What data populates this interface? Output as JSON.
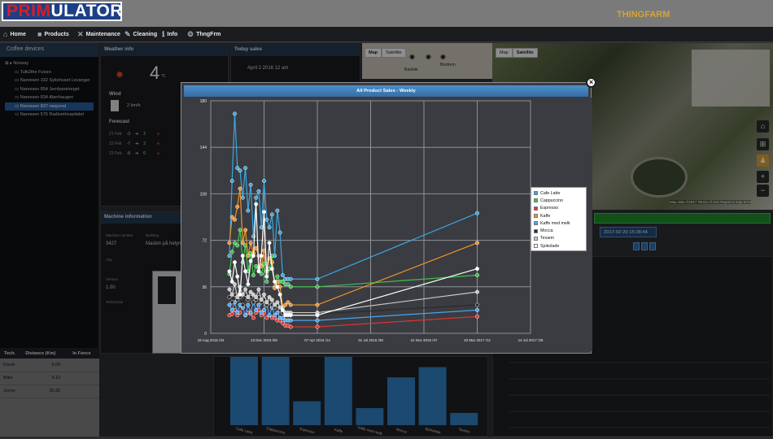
{
  "app": {
    "logo_prefix": "PRIM",
    "logo_suffix": "ULATOR",
    "brand": "THINGFARM"
  },
  "nav": [
    {
      "label": "Home",
      "icon": "home-icon",
      "glyph": "⌂"
    },
    {
      "label": "Products",
      "icon": "products-icon",
      "glyph": "■"
    },
    {
      "label": "Maintenance",
      "icon": "wrench-icon",
      "glyph": "✕"
    },
    {
      "label": "Cleaning",
      "icon": "brush-icon",
      "glyph": "✎"
    },
    {
      "label": "Info",
      "icon": "info-icon",
      "glyph": "ℹ"
    },
    {
      "label": "ThngFrm",
      "icon": "thingfarm-icon",
      "glyph": "⚙"
    }
  ],
  "sidebar": {
    "title": "Coffee devices",
    "tree": [
      "Norway",
      "Tulk2the Future",
      "Narvesen 332 Sykehuset Levanger",
      "Narvesen 854 Jernbanetorget",
      "Narvesen 834 Aberhaugen",
      "Narvesen 837 nasjonal",
      "Narvesen 576 Radiumhospitalet"
    ],
    "selected_index": 5
  },
  "tech_table": {
    "headers": [
      "Tech.",
      "Distance (Km)",
      "In Fence"
    ],
    "rows": [
      [
        "David",
        "9.00",
        ""
      ],
      [
        "Mike",
        "9.10",
        ""
      ],
      [
        "Jonny",
        "39.20",
        ""
      ]
    ]
  },
  "weather": {
    "title": "Weather info",
    "temperature": "4",
    "unit": "°C",
    "wind_label": "Wind",
    "wind_value": "2 km/h",
    "forecast_label": "Forecast",
    "forecast": [
      {
        "day": "21 Feb",
        "temp": "-3",
        "wind": "2"
      },
      {
        "day": "22 Feb",
        "temp": "-7",
        "wind": "2"
      },
      {
        "day": "23 Feb",
        "temp": "-8",
        "wind": "0"
      }
    ]
  },
  "today_sales": {
    "title": "Today sales",
    "date": "April 2 2016 12 am"
  },
  "machine": {
    "title": "Machine information",
    "number_label": "Machine number",
    "number": "3427",
    "building_label": "Building",
    "building": "Maskin på helyro",
    "city_label": "City",
    "version_label": "Version",
    "version": "1.00",
    "technician_label": "Technician"
  },
  "maps": {
    "map_label": "Map",
    "satellite_label": "Satellite",
    "place": "Bardvik",
    "place2": "Bestrem",
    "attribution": "Map data ©2017  Terms of Use  Report a map error"
  },
  "right_panel": {
    "date": "2017-02-20 15:28:44"
  },
  "modal": {
    "title": "All Product Sales - Weekly"
  },
  "chart_data": {
    "type": "line",
    "title": "All Product Sales - Weekly",
    "x_ticks": [
      "19 Aug 2015 /34",
      "13 Dec 2015 /50",
      "07 Apr 2016 /14",
      "31 Jul 2016 /30",
      "24 Nov 2016 /47",
      "20 Mar 2017 /12",
      "14 Jul 2017 /28"
    ],
    "y_ticks": [
      0,
      36,
      72,
      108,
      144,
      180
    ],
    "ylim": [
      0,
      180
    ],
    "legend_position": "right",
    "grid": true,
    "series": [
      {
        "name": "Cafe Latte",
        "color": "#3aa7e0",
        "values": [
          [
            0.35,
            60
          ],
          [
            0.4,
            118
          ],
          [
            0.45,
            170
          ],
          [
            0.5,
            128
          ],
          [
            0.55,
            126
          ],
          [
            0.6,
            105
          ],
          [
            0.65,
            128
          ],
          [
            0.7,
            95
          ],
          [
            0.75,
            115
          ],
          [
            0.8,
            75
          ],
          [
            0.85,
            105
          ],
          [
            0.9,
            110
          ],
          [
            0.95,
            82
          ],
          [
            1.0,
            118
          ],
          [
            1.05,
            88
          ],
          [
            1.1,
            82
          ],
          [
            1.15,
            92
          ],
          [
            1.2,
            60
          ],
          [
            1.25,
            95
          ],
          [
            1.3,
            78
          ],
          [
            1.35,
            45
          ],
          [
            1.4,
            42
          ],
          [
            1.45,
            42
          ],
          [
            1.5,
            42
          ],
          [
            2.0,
            42
          ],
          [
            5.0,
            93
          ]
        ]
      },
      {
        "name": "Cappuccino",
        "color": "#3ac24a",
        "values": [
          [
            0.35,
            46
          ],
          [
            0.4,
            63
          ],
          [
            0.45,
            70
          ],
          [
            0.5,
            68
          ],
          [
            0.55,
            80
          ],
          [
            0.6,
            55
          ],
          [
            0.65,
            68
          ],
          [
            0.7,
            48
          ],
          [
            0.75,
            62
          ],
          [
            0.8,
            45
          ],
          [
            0.85,
            52
          ],
          [
            0.9,
            50
          ],
          [
            0.95,
            46
          ],
          [
            1.0,
            54
          ],
          [
            1.05,
            40
          ],
          [
            1.1,
            50
          ],
          [
            1.15,
            60
          ],
          [
            1.2,
            36
          ],
          [
            1.25,
            44
          ],
          [
            1.3,
            40
          ],
          [
            1.35,
            40
          ],
          [
            1.4,
            38
          ],
          [
            1.45,
            38
          ],
          [
            1.5,
            36
          ],
          [
            2.0,
            36
          ],
          [
            5.0,
            45
          ]
        ]
      },
      {
        "name": "Espresso",
        "color": "#e03434",
        "values": [
          [
            0.35,
            14
          ],
          [
            0.4,
            15
          ],
          [
            0.45,
            18
          ],
          [
            0.5,
            14
          ],
          [
            0.55,
            16
          ],
          [
            0.6,
            20
          ],
          [
            0.65,
            14
          ],
          [
            0.7,
            16
          ],
          [
            0.75,
            15
          ],
          [
            0.8,
            12
          ],
          [
            0.85,
            16
          ],
          [
            0.9,
            18
          ],
          [
            0.95,
            14
          ],
          [
            1.0,
            16
          ],
          [
            1.05,
            12
          ],
          [
            1.1,
            14
          ],
          [
            1.15,
            12
          ],
          [
            1.2,
            12
          ],
          [
            1.25,
            10
          ],
          [
            1.3,
            10
          ],
          [
            1.35,
            8
          ],
          [
            1.4,
            6
          ],
          [
            1.45,
            6
          ],
          [
            1.5,
            5
          ],
          [
            2.0,
            5
          ],
          [
            5.0,
            13
          ]
        ]
      },
      {
        "name": "Kaffe",
        "color": "#f0942a",
        "values": [
          [
            0.35,
            70
          ],
          [
            0.4,
            90
          ],
          [
            0.45,
            88
          ],
          [
            0.5,
            98
          ],
          [
            0.55,
            112
          ],
          [
            0.6,
            70
          ],
          [
            0.65,
            80
          ],
          [
            0.7,
            60
          ],
          [
            0.75,
            70
          ],
          [
            0.8,
            62
          ],
          [
            0.85,
            66
          ],
          [
            0.9,
            60
          ],
          [
            0.95,
            52
          ],
          [
            1.0,
            64
          ],
          [
            1.05,
            48
          ],
          [
            1.1,
            58
          ],
          [
            1.15,
            55
          ],
          [
            1.2,
            35
          ],
          [
            1.25,
            40
          ],
          [
            1.3,
            36
          ],
          [
            1.35,
            20
          ],
          [
            1.4,
            22
          ],
          [
            1.45,
            24
          ],
          [
            1.5,
            22
          ],
          [
            2.0,
            22
          ],
          [
            5.0,
            70
          ]
        ]
      },
      {
        "name": "Kaffe med melk",
        "color": "#4aa3f0",
        "values": [
          [
            0.35,
            22
          ],
          [
            0.4,
            18
          ],
          [
            0.45,
            24
          ],
          [
            0.5,
            16
          ],
          [
            0.55,
            22
          ],
          [
            0.6,
            20
          ],
          [
            0.65,
            14
          ],
          [
            0.7,
            22
          ],
          [
            0.75,
            16
          ],
          [
            0.8,
            24
          ],
          [
            0.85,
            18
          ],
          [
            0.9,
            22
          ],
          [
            0.95,
            16
          ],
          [
            1.0,
            18
          ],
          [
            1.05,
            22
          ],
          [
            1.1,
            14
          ],
          [
            1.15,
            20
          ],
          [
            1.2,
            14
          ],
          [
            1.25,
            16
          ],
          [
            1.3,
            12
          ],
          [
            1.35,
            12
          ],
          [
            1.4,
            10
          ],
          [
            1.45,
            10
          ],
          [
            1.5,
            10
          ],
          [
            2.0,
            10
          ],
          [
            5.0,
            18
          ]
        ]
      },
      {
        "name": "Mocca",
        "color": "#2a2a2a",
        "values": [
          [
            0.35,
            28
          ],
          [
            0.4,
            24
          ],
          [
            0.45,
            30
          ],
          [
            0.5,
            26
          ],
          [
            0.55,
            28
          ],
          [
            0.6,
            22
          ],
          [
            0.65,
            30
          ],
          [
            0.7,
            26
          ],
          [
            0.75,
            28
          ],
          [
            0.8,
            24
          ],
          [
            0.85,
            26
          ],
          [
            0.9,
            28
          ],
          [
            0.95,
            24
          ],
          [
            1.0,
            26
          ],
          [
            1.05,
            22
          ],
          [
            1.1,
            24
          ],
          [
            1.15,
            22
          ],
          [
            1.2,
            20
          ],
          [
            1.25,
            22
          ],
          [
            1.3,
            18
          ],
          [
            1.35,
            16
          ],
          [
            1.4,
            16
          ],
          [
            1.45,
            15
          ],
          [
            1.5,
            15
          ],
          [
            2.0,
            15
          ],
          [
            5.0,
            22
          ]
        ]
      },
      {
        "name": "Tevann",
        "color": "#c9c9c9",
        "values": [
          [
            0.35,
            34
          ],
          [
            0.4,
            30
          ],
          [
            0.45,
            38
          ],
          [
            0.5,
            28
          ],
          [
            0.55,
            36
          ],
          [
            0.6,
            30
          ],
          [
            0.65,
            34
          ],
          [
            0.7,
            28
          ],
          [
            0.75,
            32
          ],
          [
            0.8,
            30
          ],
          [
            0.85,
            28
          ],
          [
            0.9,
            34
          ],
          [
            0.95,
            26
          ],
          [
            1.0,
            30
          ],
          [
            1.05,
            24
          ],
          [
            1.1,
            28
          ],
          [
            1.15,
            26
          ],
          [
            1.2,
            22
          ],
          [
            1.25,
            24
          ],
          [
            1.3,
            20
          ],
          [
            1.35,
            18
          ],
          [
            1.4,
            16
          ],
          [
            1.45,
            16
          ],
          [
            1.5,
            16
          ],
          [
            2.0,
            16
          ],
          [
            5.0,
            32
          ]
        ]
      },
      {
        "name": "Sjokolade",
        "color": "#ffffff",
        "values": [
          [
            0.35,
            48
          ],
          [
            0.4,
            40
          ],
          [
            0.45,
            55
          ],
          [
            0.5,
            44
          ],
          [
            0.55,
            30
          ],
          [
            0.6,
            60
          ],
          [
            0.65,
            48
          ],
          [
            0.7,
            38
          ],
          [
            0.75,
            56
          ],
          [
            0.8,
            60
          ],
          [
            0.85,
            100
          ],
          [
            0.9,
            48
          ],
          [
            0.95,
            60
          ],
          [
            1.0,
            94
          ],
          [
            1.05,
            44
          ],
          [
            1.1,
            70
          ],
          [
            1.15,
            50
          ],
          [
            1.2,
            40
          ],
          [
            1.25,
            36
          ],
          [
            1.3,
            30
          ],
          [
            1.35,
            18
          ],
          [
            1.4,
            14
          ],
          [
            1.45,
            14
          ],
          [
            1.5,
            14
          ],
          [
            2.0,
            14
          ],
          [
            5.0,
            50
          ]
        ]
      }
    ]
  },
  "bar_panel": {
    "chart_data": {
      "type": "bar",
      "categories": [
        "Cafe Latte",
        "Cappuccino",
        "Espresso",
        "Kaffe",
        "Kaffe med melk",
        "Mocca",
        "Sjokolade",
        "Tevann"
      ],
      "values": [
        100,
        100,
        35,
        100,
        25,
        70,
        85,
        18
      ]
    }
  }
}
